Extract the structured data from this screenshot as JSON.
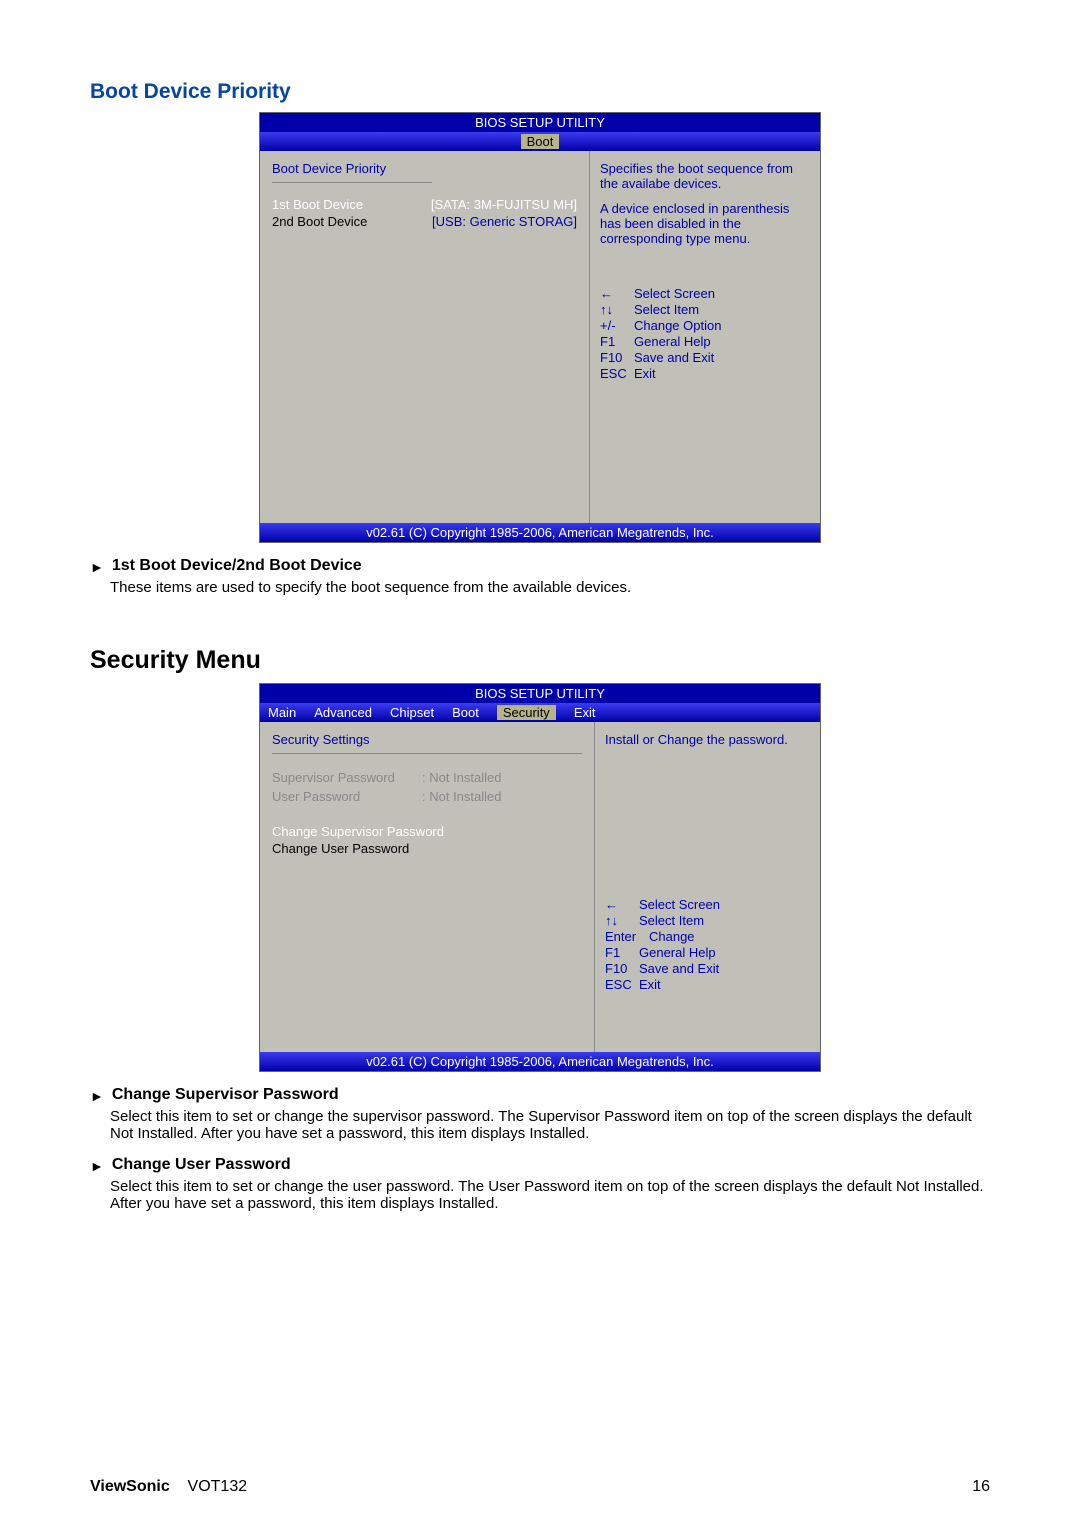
{
  "boot_section": {
    "heading": "Boot Device Priority",
    "bios": {
      "title": "BIOS SETUP UTILITY",
      "active_tab": "Boot",
      "left": {
        "header": "Boot Device Priority",
        "row1_label": "1st Boot Device",
        "row1_value": "[SATA: 3M-FUJITSU MH]",
        "row2_label": "2nd Boot Device",
        "row2_value": "[USB: Generic STORAG]"
      },
      "right": {
        "desc1": "Specifies the boot sequence from the availabe devices.",
        "desc2": "A device enclosed in parenthesis has been disabled in the corresponding type menu.",
        "keys": {
          "k1": "←",
          "d1": "Select Screen",
          "k2": "↑↓",
          "d2": "Select Item",
          "k3": "+/-",
          "d3": "Change Option",
          "k4": "F1",
          "d4": "General Help",
          "k5": "F10",
          "d5": "Save and Exit",
          "k6": "ESC",
          "d6": "Exit"
        }
      },
      "footer": "v02.61 (C) Copyright 1985-2006, American Megatrends, Inc."
    },
    "item1_heading": "1st Boot Device/2nd Boot Device",
    "item1_text": "These items are used to specify the boot sequence from the available devices."
  },
  "security_section": {
    "heading": "Security Menu",
    "bios": {
      "title": "BIOS SETUP UTILITY",
      "tabs": {
        "main": "Main",
        "advanced": "Advanced",
        "chipset": "Chipset",
        "boot": "Boot",
        "security": "Security",
        "exit": "Exit"
      },
      "left": {
        "header": "Security Settings",
        "sup_label": "Supervisor Password",
        "sup_val": ": Not Installed",
        "user_label": "User Password",
        "user_val": ": Not Installed",
        "action1": "Change Supervisor Password",
        "action2": "Change User Password"
      },
      "right": {
        "desc": "Install or Change the password.",
        "keys": {
          "k1": "←",
          "d1": "Select Screen",
          "k2": "↑↓",
          "d2": "Select Item",
          "k3": "Enter",
          "d3": "Change",
          "k4": "F1",
          "d4": "General Help",
          "k5": "F10",
          "d5": "Save and Exit",
          "k6": "ESC",
          "d6": "Exit"
        }
      },
      "footer": "v02.61 (C) Copyright 1985-2006, American Megatrends, Inc."
    },
    "item1_heading": "Change Supervisor Password",
    "item1_text": "Select this item to set or change the supervisor password. The Supervisor Password item on top of the screen displays the default Not Installed. After you have set a password, this item displays Installed.",
    "item2_heading": "Change User Password",
    "item2_text": "Select this item to set or change the user password. The User Password item on top of the screen displays the default Not Installed. After you have set a password, this item displays Installed."
  },
  "page_footer": {
    "brand": "ViewSonic",
    "model": "VOT132",
    "page": "16"
  }
}
